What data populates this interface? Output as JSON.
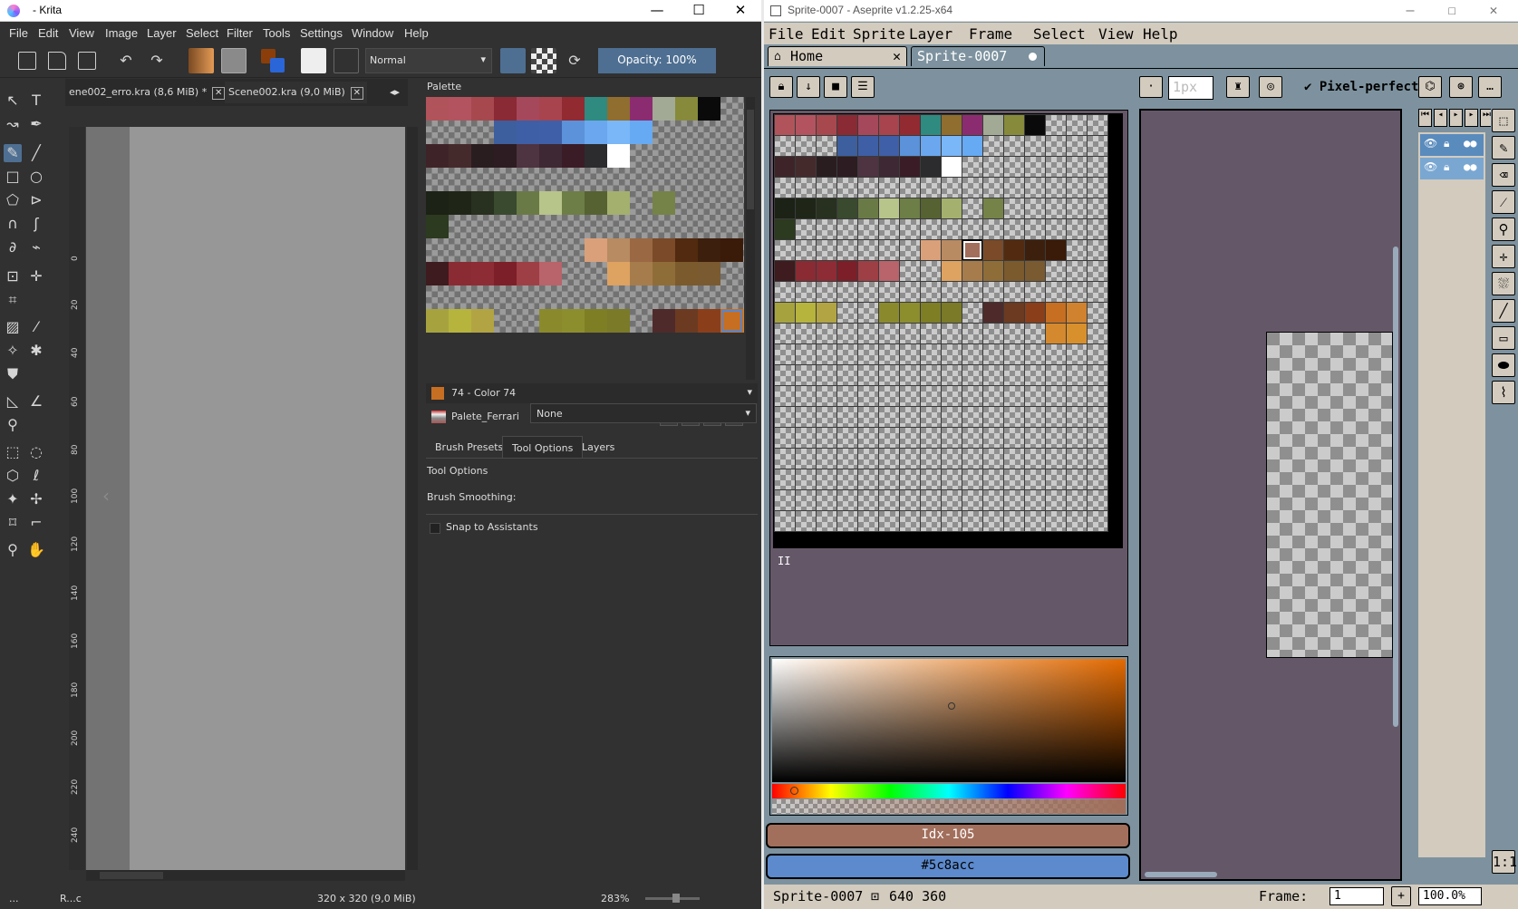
{
  "krita": {
    "title": "- Krita",
    "menu": [
      "File",
      "Edit",
      "View",
      "Image",
      "Layer",
      "Select",
      "Filter",
      "Tools",
      "Settings",
      "Window",
      "Help"
    ],
    "blend_mode": "Normal",
    "opacity": "Opacity: 100%",
    "tabs": [
      {
        "label": "ene002_erro.kra (8,6 MiB) *"
      },
      {
        "label": "Scene002.kra (9,0 MiB)"
      }
    ],
    "ruler_ticks": [
      "0",
      "20",
      "40",
      "60",
      "80",
      "100",
      "120",
      "140",
      "160",
      "180",
      "200",
      "220",
      "240"
    ],
    "palette_docker": {
      "title": "Palette",
      "current_color": "74 - Color 74",
      "current_color_hex": "#c66f22",
      "palette_name": "Palete_Ferrari",
      "rows": [
        [
          "#b1535a",
          "#b45360",
          "#a7484f",
          "#8a2a34",
          "#a6485b",
          "#a7444d",
          "#922a32",
          "#2f8a80",
          "#8f6e2f",
          "#8c2c70",
          "#a2aa95",
          "#878a3b",
          "#0a0a0a",
          "",
          "",
          ""
        ],
        [
          "",
          "",
          "",
          "#3e5f9e",
          "#3e5fa5",
          "#3f5fa8",
          "#5b92d9",
          "#6aa7ee",
          "#7ab7f9",
          "#66aaf3",
          "",
          "",
          "",
          "",
          "",
          ""
        ],
        [
          "#3e2428",
          "#452a2c",
          "#2a1d20",
          "#2d1c22",
          "#4e3340",
          "#3e2834",
          "#3a1c26",
          "#2c2c2e",
          "#ffffff",
          "",
          "",
          "",
          "",
          "",
          "",
          ""
        ],
        [
          "",
          "",
          "",
          "",
          "",
          "",
          "",
          "",
          "",
          "",
          "",
          "",
          "",
          "",
          "",
          ""
        ],
        [
          "#1c2216",
          "#1f2618",
          "#28301f",
          "#3a4a2e",
          "#6a7a47",
          "#b7c48a",
          "#6d7e46",
          "#566232",
          "#a3b06e",
          "",
          "#758348",
          "",
          "",
          "",
          "",
          ""
        ],
        [
          "#2c3a1f",
          "",
          "",
          "",
          "",
          "",
          "",
          "",
          "",
          "",
          "",
          "",
          "",
          "",
          "",
          ""
        ],
        [
          "",
          "",
          "",
          "",
          "",
          "",
          "",
          "#daa07a",
          "#b88b62",
          "#9b6844",
          "#7a4a29",
          "#522a10",
          "#3d1f0d",
          "#3a1a08",
          "",
          ""
        ],
        [
          "#3e1b1e",
          "#8a2b33",
          "#8d2c35",
          "#7d1f28",
          "#9e3f45",
          "#b9636b",
          "",
          "",
          "#dea261",
          "#a67c4c",
          "#8f6d38",
          "#7b5a2d",
          "#7a5a31",
          "",
          "",
          ""
        ],
        [
          "",
          "",
          "",
          "",
          "",
          "",
          "",
          "",
          "",
          "",
          "",
          "",
          "",
          "",
          "",
          ""
        ],
        [
          "#a6a33f",
          "#b6b43d",
          "#b2a442",
          "",
          "",
          "#8a8a2d",
          "#8c8e2e",
          "#7e7e25",
          "#7a7a28",
          "",
          "#4f2a2a",
          "#6b3a21",
          "#8b3e1a",
          "#c66f22",
          "#d0822e",
          ""
        ]
      ],
      "selected_row": 9,
      "selected_col": 13
    },
    "docker_tabs": [
      "Brush Presets",
      "Tool Options",
      "Layers"
    ],
    "tool_options": {
      "title": "Tool Options",
      "brush_smoothing_label": "Brush Smoothing:",
      "brush_smoothing_value": "None",
      "snap_label": "Snap to Assistants"
    },
    "status": {
      "left": "...",
      "layer": "R...c",
      "size": "320 x 320 (9,0 MiB)",
      "zoom": "283%"
    }
  },
  "aseprite": {
    "title": "Sprite-0007 - Aseprite v1.2.25-x64",
    "menu": [
      "File",
      "Edit",
      "Sprite",
      "Layer",
      "Frame",
      "Select",
      "View",
      "Help"
    ],
    "tabs": {
      "home": "Home",
      "sprite": "Sprite-0007"
    },
    "brush_size": "1px",
    "pixel_perfect": "Pixel-perfect",
    "palette": {
      "rows": [
        [
          "#b1535a",
          "#b45360",
          "#a7484f",
          "#8a2a34",
          "#a6485b",
          "#a7444d",
          "#922a32",
          "#2f8a80",
          "#8f6e2f",
          "#8c2c70",
          "#a2aa95",
          "#878a3b",
          "#0a0a0a",
          "",
          "",
          ""
        ],
        [
          "",
          "",
          "",
          "#3e5f9e",
          "#3e5fa5",
          "#3f5fa8",
          "#5b92d9",
          "#6aa7ee",
          "#7ab7f9",
          "#66aaf3",
          "",
          "",
          "",
          "",
          "",
          ""
        ],
        [
          "#3e2428",
          "#452a2c",
          "#2a1d20",
          "#2d1c22",
          "#4e3340",
          "#3e2834",
          "#3a1c26",
          "#2c2c2e",
          "#ffffff",
          "",
          "",
          "",
          "",
          "",
          "",
          ""
        ],
        [
          "",
          "",
          "",
          "",
          "",
          "",
          "",
          "",
          "",
          "",
          "",
          "",
          "",
          "",
          "",
          ""
        ],
        [
          "#1c2216",
          "#1f2618",
          "#28301f",
          "#3a4a2e",
          "#6a7a47",
          "#b7c48a",
          "#6d7e46",
          "#566232",
          "#a3b06e",
          "",
          "#758348",
          "",
          "",
          "",
          "",
          ""
        ],
        [
          "#2c3a1f",
          "",
          "",
          "",
          "",
          "",
          "",
          "",
          "",
          "",
          "",
          "",
          "",
          "",
          "",
          ""
        ],
        [
          "",
          "",
          "",
          "",
          "",
          "",
          "",
          "#daa07a",
          "#b88b62",
          "#a26f5c",
          "#7a4a29",
          "#522a10",
          "#3d1f0d",
          "#3a1a08",
          "",
          ""
        ],
        [
          "#3e1b1e",
          "#8a2b33",
          "#8d2c35",
          "#7d1f28",
          "#9e3f45",
          "#b9636b",
          "",
          "",
          "#dea261",
          "#a67c4c",
          "#8f6d38",
          "#7b5a2d",
          "#7a5a31",
          "",
          "",
          ""
        ],
        [
          "",
          "",
          "",
          "",
          "",
          "",
          "",
          "",
          "",
          "",
          "",
          "",
          "",
          "",
          "",
          ""
        ],
        [
          "#a6a33f",
          "#b6b43d",
          "#b2a442",
          "",
          "",
          "#8a8a2d",
          "#8c8e2e",
          "#7e7e25",
          "#7a7a28",
          "",
          "#4f2a2a",
          "#6b3a21",
          "#8b3e1a",
          "#c66f22",
          "#d0822e",
          ""
        ],
        [
          "",
          "",
          "",
          "",
          "",
          "",
          "",
          "",
          "",
          "",
          "",
          "",
          "",
          "#d4892e",
          "#d8902d",
          ""
        ],
        [
          "",
          "",
          "",
          "",
          "",
          "",
          "",
          "",
          "",
          "",
          "",
          "",
          "",
          "",
          "",
          ""
        ],
        [
          "",
          "",
          "",
          "",
          "",
          "",
          "",
          "",
          "",
          "",
          "",
          "",
          "",
          "",
          "",
          ""
        ],
        [
          "",
          "",
          "",
          "",
          "",
          "",
          "",
          "",
          "",
          "",
          "",
          "",
          "",
          "",
          "",
          ""
        ],
        [
          "",
          "",
          "",
          "",
          "",
          "",
          "",
          "",
          "",
          "",
          "",
          "",
          "",
          "",
          "",
          ""
        ],
        [
          "",
          "",
          "",
          "",
          "",
          "",
          "",
          "",
          "",
          "",
          "",
          "",
          "",
          "",
          "",
          ""
        ],
        [
          "",
          "",
          "",
          "",
          "",
          "",
          "",
          "",
          "",
          "",
          "",
          "",
          "",
          "",
          "",
          ""
        ],
        [
          "",
          "",
          "",
          "",
          "",
          "",
          "",
          "",
          "",
          "",
          "",
          "",
          "",
          "",
          "",
          ""
        ],
        [
          "",
          "",
          "",
          "",
          "",
          "",
          "",
          "",
          "",
          "",
          "",
          "",
          "",
          "",
          "",
          ""
        ],
        [
          "",
          "",
          "",
          "",
          "",
          "",
          "",
          "",
          "",
          "",
          "",
          "",
          "",
          "",
          "",
          ""
        ]
      ],
      "selected_row": 6,
      "selected_col": 9,
      "pause": "II"
    },
    "fg_color": "Idx-105",
    "bg_color": "#5c8acc",
    "status": {
      "sprite": "Sprite-0007",
      "size": "640 360",
      "frame_label": "Frame:",
      "frame_value": "1",
      "zoom": "100.0%"
    }
  }
}
